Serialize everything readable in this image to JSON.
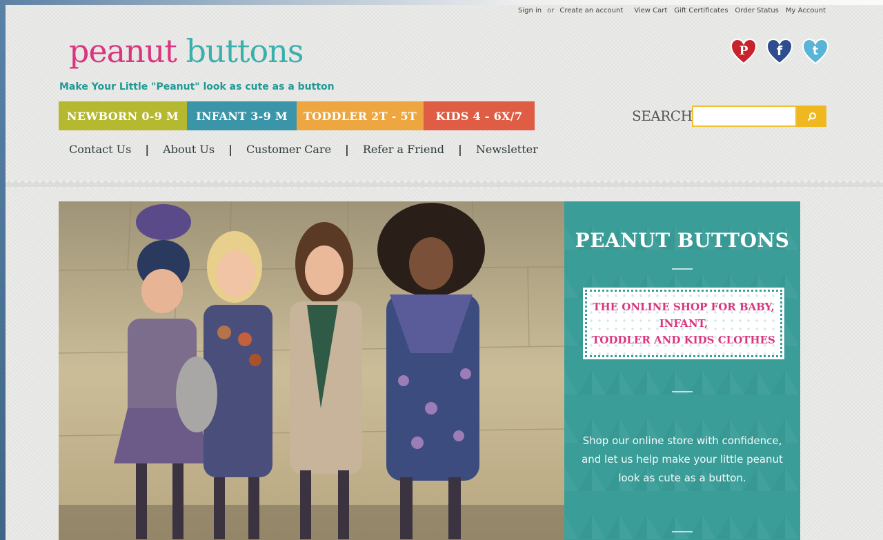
{
  "util": {
    "sign_in": "Sign in",
    "or": "or",
    "create_account": "Create an account",
    "view_cart": "View Cart",
    "gift_certificates": "Gift Certificates",
    "order_status": "Order Status",
    "my_account": "My Account"
  },
  "brand": {
    "logo_word1": "peanut",
    "logo_word2": "buttons",
    "tagline": "Make Your Little \"Peanut\" look as cute as a button",
    "pink": "#d8377f",
    "teal": "#3ab0ad"
  },
  "social": [
    {
      "name": "pinterest-icon",
      "color": "#c8232c"
    },
    {
      "name": "facebook-icon",
      "color": "#2d4d8e"
    },
    {
      "name": "twitter-icon",
      "color": "#5ab4d6"
    }
  ],
  "categories": [
    {
      "label": "NEWBORN 0-9 M",
      "color": "#b5b92f"
    },
    {
      "label": "INFANT 3-9 M",
      "color": "#3a95a8"
    },
    {
      "label": "TODDLER 2T - 5T",
      "color": "#eda640"
    },
    {
      "label": "KIDS 4 - 6X/7",
      "color": "#e05d45"
    }
  ],
  "search": {
    "label": "SEARCH:",
    "placeholder": "",
    "value": ""
  },
  "secondary_nav": [
    "Contact Us",
    "About Us",
    "Customer Care",
    "Refer a Friend",
    "Newsletter"
  ],
  "hero": {
    "title": "PEANUT BUTTONS",
    "stamp_line1": "THE ONLINE SHOP FOR BABY,",
    "stamp_line2": "INFANT,",
    "stamp_line3": "TODDLER AND KIDS CLOTHES",
    "copy_line1": "Shop our online store with confidence,",
    "copy_line2": "and let us help make your little peanut",
    "copy_line3": "look as cute as a button.",
    "panel_color": "#3a9d98"
  }
}
